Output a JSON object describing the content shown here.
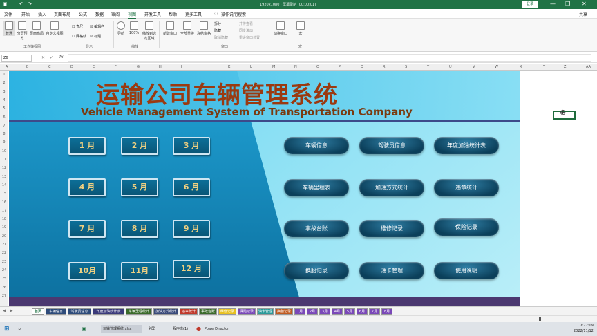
{
  "app": {
    "window_title": "1920x1080 · 屏幕录制 [00:00:01]",
    "login": "登录"
  },
  "menu": [
    "文件",
    "开始",
    "插入",
    "页面布局",
    "公式",
    "数据",
    "审阅",
    "视图",
    "开发工具",
    "帮助",
    "更多工具",
    "操作说明搜索"
  ],
  "share": "共享",
  "ribbon": {
    "buttons": [
      "普通",
      "分页预览",
      "页面布局",
      "自定义视图",
      "导航",
      "显示比例",
      "100%",
      "缩放到选定区域",
      "新建窗口",
      "全部重排",
      "冻结窗格",
      "切换窗口",
      "宏"
    ],
    "checks": [
      "直尺",
      "编辑栏",
      "网格线",
      "标题"
    ],
    "window_opts": [
      "拆分",
      "隐藏",
      "取消隐藏",
      "并排查看",
      "同步滚动",
      "重设窗口位置"
    ],
    "groups": [
      "工作簿视图",
      "显示",
      "缩放",
      "窗口",
      "宏"
    ]
  },
  "formula_bar": {
    "name_box": "Z6",
    "fx": "fx"
  },
  "columns": [
    "A",
    "B",
    "C",
    "D",
    "E",
    "F",
    "G",
    "H",
    "I",
    "J",
    "K",
    "L",
    "M",
    "N",
    "O",
    "P",
    "Q",
    "R",
    "S",
    "T",
    "U",
    "V",
    "W",
    "X",
    "Y",
    "Z",
    "AA"
  ],
  "rows": [
    "1",
    "2",
    "3",
    "4",
    "5",
    "6",
    "7",
    "8",
    "9",
    "10",
    "11",
    "12",
    "13",
    "14",
    "15",
    "16",
    "17",
    "18",
    "19",
    "20",
    "21",
    "22",
    "23",
    "24",
    "25",
    "26",
    "27"
  ],
  "dashboard": {
    "title": "运输公司车辆管理系统",
    "subtitle": "Vehicle Management System of Transportation Company",
    "months": [
      "1 月",
      "2 月",
      "3 月",
      "4 月",
      "5 月",
      "6 月",
      "7 月",
      "8 月",
      "9 月",
      "10月",
      "11月",
      "12 月"
    ],
    "functions": [
      "车辆信息",
      "驾驶员信息",
      "年度加油统计表",
      "车辆里程表",
      "加油方式统计",
      "违章统计",
      "事故台账",
      "维修记录",
      "保险记录",
      "换胎记录",
      "油卡管理",
      "使用说明"
    ]
  },
  "sheet_tabs": [
    "首页",
    "车辆信息",
    "驾驶员信息",
    "年度加油统计表",
    "车辆里程统计",
    "加油方式统计",
    "违章统计",
    "事故台账",
    "维修记录",
    "保险记录",
    "油卡管理",
    "换胎记录",
    "1月",
    "2月",
    "3月",
    "4月",
    "5月",
    "6月",
    "7月",
    "8月"
  ],
  "sheet_tab_colors": [
    "#ffffff",
    "#2e4b7a",
    "#2e4b7a",
    "#3b3a7a",
    "#3a6a2a",
    "#3a4a7a",
    "#c0392b",
    "#3a6a2a",
    "#e8c020",
    "#7a48b8",
    "#2a9a9a",
    "#c05a20",
    "#7a48b8",
    "#7a48b8",
    "#7a48b8",
    "#7a48b8",
    "#7a48b8",
    "#7a48b8",
    "#7a48b8",
    "#7a48b8"
  ],
  "taskbar": [
    "运输管理系统.xlsx",
    "全屏",
    "程序库(1)",
    "录制中",
    "PowerDirector"
  ],
  "clock": {
    "time": "7:22:09",
    "date": "2022/11/12"
  }
}
